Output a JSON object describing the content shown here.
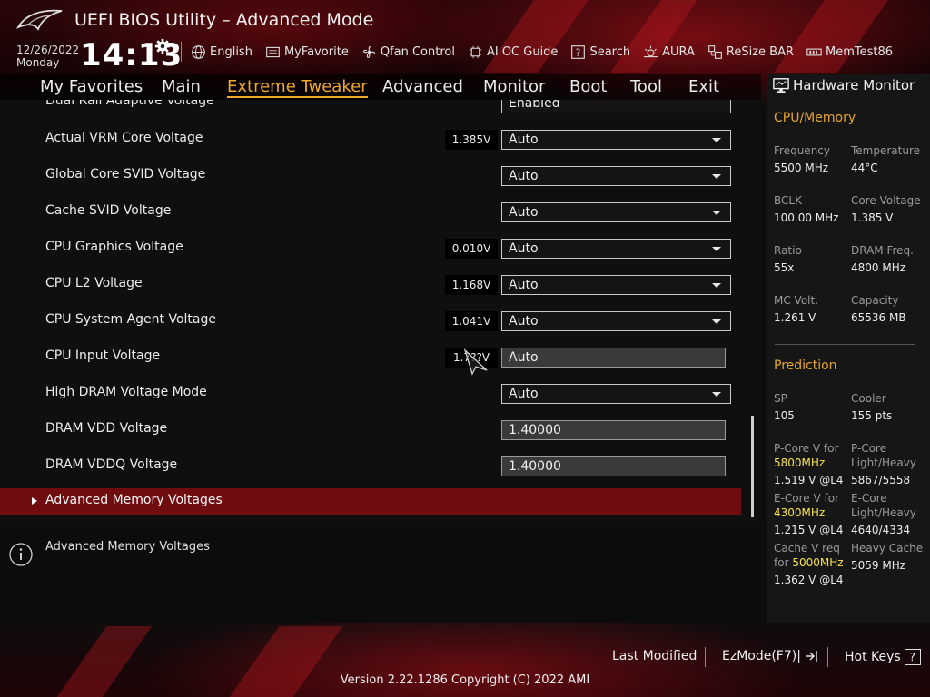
{
  "header": {
    "title": "UEFI BIOS Utility – Advanced Mode",
    "date": "12/26/2022",
    "day": "Monday",
    "time": "14:13"
  },
  "toolbar": {
    "english": "English",
    "myfavorite": "MyFavorite",
    "qfan": "Qfan Control",
    "aioc": "AI OC Guide",
    "search": "Search",
    "aura": "AURA",
    "resizebar": "ReSize BAR",
    "memtest": "MemTest86"
  },
  "tabs": {
    "favorites": "My Favorites",
    "main": "Main",
    "extreme": "Extreme Tweaker",
    "advanced": "Advanced",
    "monitor": "Monitor",
    "boot": "Boot",
    "tool": "Tool",
    "exit": "Exit"
  },
  "settings": {
    "partial_label": "Dual Rail Adaptive Voltage",
    "partial_value": "Enabled",
    "rows": [
      {
        "label": "Actual VRM Core Voltage",
        "reading": "1.385V",
        "value": "Auto"
      },
      {
        "label": "Global Core SVID Voltage",
        "reading": "",
        "value": "Auto"
      },
      {
        "label": "Cache SVID Voltage",
        "reading": "",
        "value": "Auto"
      },
      {
        "label": "CPU Graphics Voltage",
        "reading": "0.010V",
        "value": "Auto"
      },
      {
        "label": "CPU L2 Voltage",
        "reading": "1.168V",
        "value": "Auto"
      },
      {
        "label": "CPU System Agent Voltage",
        "reading": "1.041V",
        "value": "Auto"
      },
      {
        "label": "CPU Input Voltage",
        "reading": "1.7??V",
        "value": "Auto"
      },
      {
        "label": "High DRAM Voltage Mode",
        "reading": "",
        "value": "Auto"
      },
      {
        "label": "DRAM VDD Voltage",
        "reading": "",
        "value": "1.40000"
      },
      {
        "label": "DRAM VDDQ Voltage",
        "reading": "",
        "value": "1.40000"
      }
    ],
    "submenu": "Advanced Memory Voltages"
  },
  "help": {
    "text": "Advanced Memory Voltages"
  },
  "hw": {
    "title": "Hardware Monitor",
    "cpu_section": "CPU/Memory",
    "frequency_label": "Frequency",
    "frequency": "5500 MHz",
    "temperature_label": "Temperature",
    "temperature": "44°C",
    "bclk_label": "BCLK",
    "bclk": "100.00 MHz",
    "corev_label": "Core Voltage",
    "corev": "1.385 V",
    "ratio_label": "Ratio",
    "ratio": "55x",
    "dramf_label": "DRAM Freq.",
    "dramf": "4800 MHz",
    "mcv_label": "MC Volt.",
    "mcv": "1.261 V",
    "capacity_label": "Capacity",
    "capacity": "65536 MB",
    "prediction_section": "Prediction",
    "sp_label": "SP",
    "sp": "105",
    "cooler_label": "Cooler",
    "cooler": "155 pts",
    "pcorev_label": "P-Core V for",
    "pcorev_freq": "5800MHz",
    "pcorev": "1.519 V @L4",
    "pcore_lh_label1": "P-Core",
    "pcore_lh_label2": "Light/Heavy",
    "pcore_lh": "5867/5558",
    "ecorev_label": "E-Core V for",
    "ecorev_freq": "4300MHz",
    "ecorev": "1.215 V @L4",
    "ecore_lh_label1": "E-Core",
    "ecore_lh_label2": "Light/Heavy",
    "ecore_lh": "4640/4334",
    "cachev_label1": "Cache V req",
    "cachev_label2": "for",
    "cachev_freq": "5000MHz",
    "cachev": "1.362 V @L4",
    "heavycache_label": "Heavy Cache",
    "heavycache": "5059 MHz"
  },
  "footer": {
    "last_modified": "Last Modified",
    "ezmode": "EzMode(F7)|",
    "hotkeys": "Hot Keys",
    "hotkeys_key": "?",
    "version": "Version 2.22.1286 Copyright (C) 2022 AMI"
  },
  "colors": {
    "accent": "#f0a92a",
    "highlight_row": "#6e0c10",
    "yellow_value": "#f5e14a"
  }
}
